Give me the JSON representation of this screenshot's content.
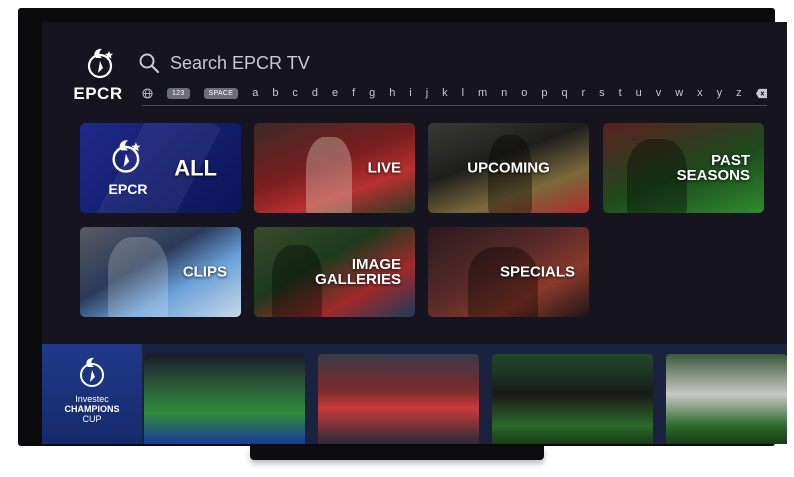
{
  "brand": {
    "logo_text": "EPCR",
    "champions_line1": "Investec",
    "champions_line2": "CHAMPIONS",
    "champions_line3": "CUP"
  },
  "search": {
    "placeholder": "Search EPCR TV"
  },
  "keyboard": {
    "keys_special": [
      "123",
      "SPACE"
    ],
    "letters": [
      "a",
      "b",
      "c",
      "d",
      "e",
      "f",
      "g",
      "h",
      "i",
      "j",
      "k",
      "l",
      "m",
      "n",
      "o",
      "p",
      "q",
      "r",
      "s",
      "t",
      "u",
      "v",
      "w",
      "x",
      "y",
      "z"
    ]
  },
  "categories": [
    {
      "label": "ALL",
      "logo_text": "EPCR"
    },
    {
      "label": "LIVE"
    },
    {
      "label": "UPCOMING"
    },
    {
      "label_line1": "PAST",
      "label_line2": "SEASONS"
    },
    {
      "label": "CLIPS"
    },
    {
      "label_line1": "IMAGE",
      "label_line2": "GALLERIES"
    },
    {
      "label": "SPECIALS"
    }
  ],
  "banner_thumbnails": 4,
  "colors": {
    "screen_bg": "#15141f",
    "tile_all_bg": "#1d2a8a",
    "banner_bg": "#1a2240"
  },
  "icons": [
    "search-icon",
    "globe-icon",
    "backspace-icon"
  ]
}
